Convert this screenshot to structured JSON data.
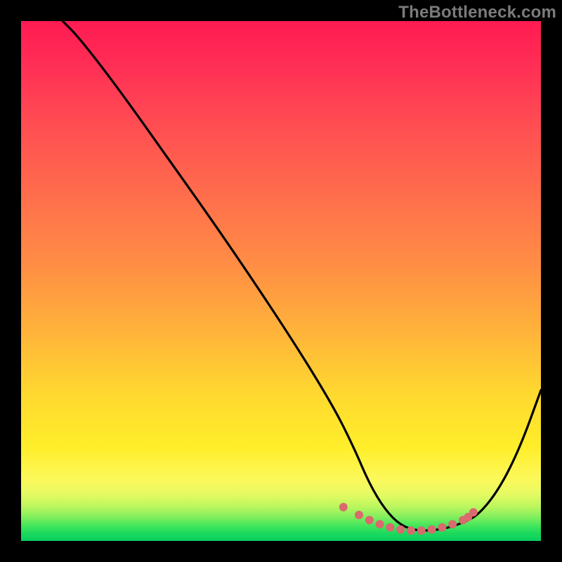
{
  "watermark": "TheBottleneck.com",
  "chart_data": {
    "type": "line",
    "title": "",
    "xlabel": "",
    "ylabel": "",
    "xlim": [
      0,
      100
    ],
    "ylim": [
      0,
      100
    ],
    "series": [
      {
        "name": "curve",
        "x": [
          8,
          11,
          18,
          28,
          40,
          52,
          60,
          64,
          67,
          70,
          73,
          76,
          79,
          82,
          85,
          88,
          92,
          96,
          100
        ],
        "y": [
          100,
          97,
          88,
          74,
          57,
          39,
          26,
          18,
          11,
          6,
          3,
          2,
          2,
          2.5,
          3.5,
          5,
          10,
          18,
          29
        ]
      }
    ],
    "markers": {
      "name": "highlight-points",
      "color": "#d96a6e",
      "x": [
        62,
        65,
        67,
        69,
        71,
        73,
        75,
        77,
        79,
        81,
        83,
        85,
        86,
        87
      ],
      "y": [
        6.5,
        5,
        4,
        3.2,
        2.6,
        2.2,
        2.0,
        2.0,
        2.2,
        2.6,
        3.2,
        4.0,
        4.6,
        5.5
      ]
    },
    "background_gradient": {
      "orientation": "vertical",
      "stops": [
        {
          "pos": 0.0,
          "color": "#ff1b52"
        },
        {
          "pos": 0.32,
          "color": "#ff6a4d"
        },
        {
          "pos": 0.6,
          "color": "#ffb43a"
        },
        {
          "pos": 0.82,
          "color": "#ffee2a"
        },
        {
          "pos": 0.93,
          "color": "#b9f65e"
        },
        {
          "pos": 1.0,
          "color": "#08cf5f"
        }
      ]
    }
  }
}
